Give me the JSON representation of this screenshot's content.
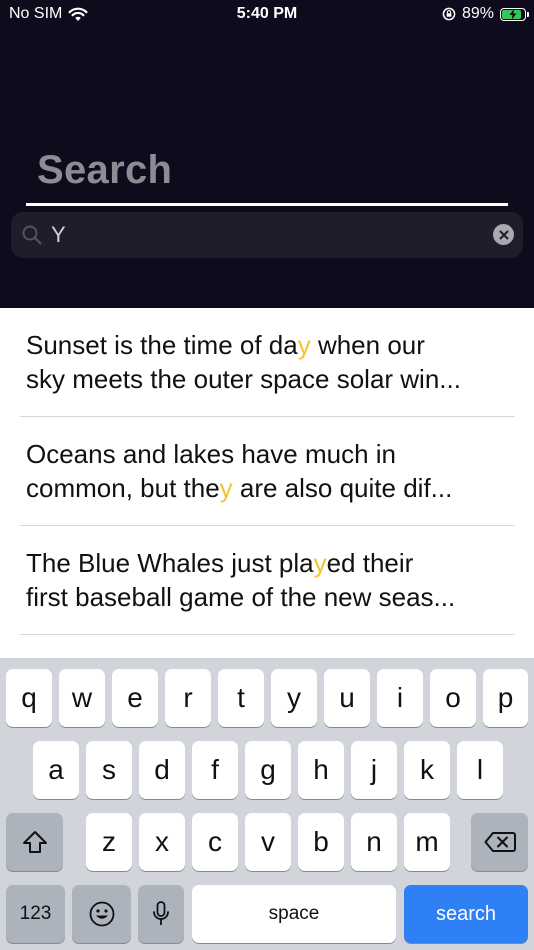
{
  "status_bar": {
    "carrier": "No SIM",
    "time": "5:40 PM",
    "battery": "89%",
    "battery_level": 0.89
  },
  "header": {
    "title": "Search"
  },
  "search": {
    "value": "Y"
  },
  "results": [
    {
      "l1_pre": "Sunset is the time of da",
      "l1_hl": "y",
      "l1_post": " when our",
      "l2_pre": "sky meets the outer space solar win...",
      "l2_hl": "",
      "l2_post": ""
    },
    {
      "l1_pre": "Oceans and lakes have much in",
      "l1_hl": "",
      "l1_post": "",
      "l2_pre": "common, but the",
      "l2_hl": "y",
      "l2_post": " are also quite dif..."
    },
    {
      "l1_pre": "The Blue Whales just pla",
      "l1_hl": "y",
      "l1_post": "ed their",
      "l2_pre": "first baseball game of the new seas...",
      "l2_hl": "",
      "l2_post": ""
    }
  ],
  "keyboard": {
    "row1": [
      "q",
      "w",
      "e",
      "r",
      "t",
      "y",
      "u",
      "i",
      "o",
      "p"
    ],
    "row2": [
      "a",
      "s",
      "d",
      "f",
      "g",
      "h",
      "j",
      "k",
      "l"
    ],
    "row3": [
      "z",
      "x",
      "c",
      "v",
      "b",
      "n",
      "m"
    ],
    "numbers_label": "123",
    "space_label": "space",
    "search_label": "search"
  },
  "colors": {
    "header_bg": "#0d0b1c",
    "highlight": "#f2c430",
    "search_key": "#2f7ff5"
  }
}
